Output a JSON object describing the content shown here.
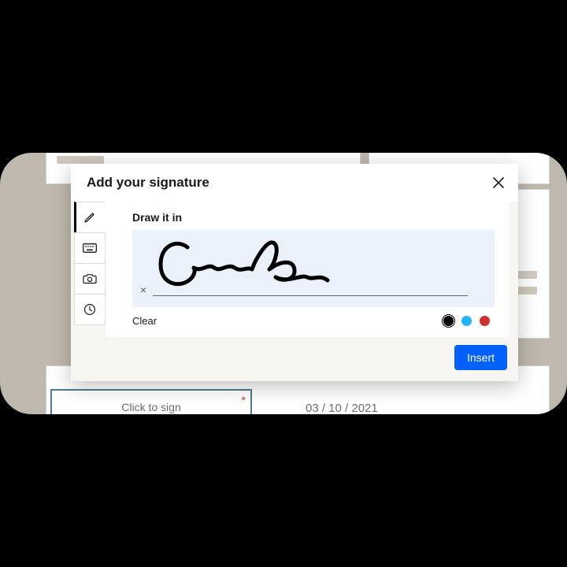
{
  "modal": {
    "title": "Add your signature",
    "panel_title": "Draw it in",
    "clear_label": "Clear",
    "insert_label": "Insert",
    "canvas_marker": "×"
  },
  "colors": {
    "black": "#000000",
    "blue": "#1fb6ff",
    "red": "#d32f2f",
    "primary": "#0061fe"
  },
  "background": {
    "sign_placeholder": "Click to sign",
    "required_mark": "*",
    "date_text": "03 / 10 / 2021"
  }
}
